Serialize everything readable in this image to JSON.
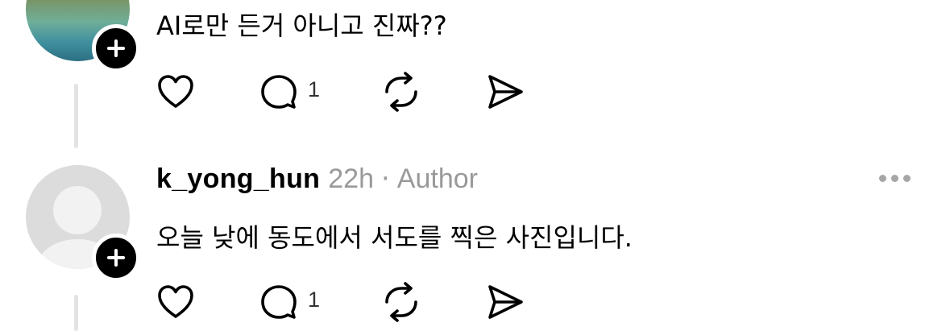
{
  "posts": [
    {
      "avatar": "lake-photo-avatar",
      "text": "AI로만 든거 아니고 진짜??",
      "actions": {
        "reply_count": "1"
      }
    },
    {
      "avatar": "default-avatar",
      "username": "k_yong_hun",
      "time": "22h",
      "separator": "·",
      "badge": "Author",
      "text": "오늘 낮에 동도에서 서도를 찍은 사진입니다.",
      "actions": {
        "reply_count": "1"
      }
    }
  ],
  "icons": {
    "follow": "plus-icon",
    "like": "heart-icon",
    "reply": "comment-icon",
    "repost": "repost-icon",
    "share": "send-icon",
    "more": "more-icon"
  },
  "colors": {
    "text": "#000000",
    "meta": "#999999",
    "thread_line": "#e3e3e3",
    "badge": "#000000"
  }
}
